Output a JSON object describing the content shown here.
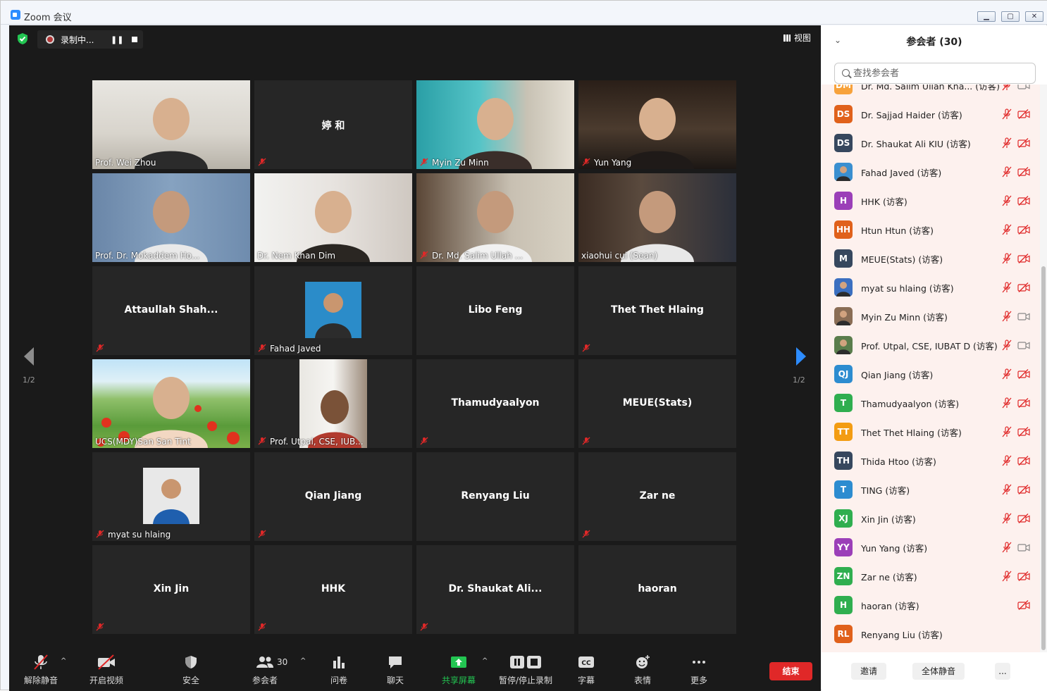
{
  "window": {
    "title": "Zoom 会议"
  },
  "topbar": {
    "recording_label": "录制中...",
    "view_label": "视图"
  },
  "tiles": [
    {
      "name": "Prof. Wei Zhou",
      "mic_off": false
    },
    {
      "name": "婷 和",
      "mic_off": true
    },
    {
      "name": "Myin Zu Minn",
      "mic_off": true
    },
    {
      "name": "Yun Yang",
      "mic_off": true
    },
    {
      "name": "Prof. Dr. Mokaddem Ho...",
      "mic_off": false
    },
    {
      "name": "Dr. Nem Khan Dim",
      "mic_off": false
    },
    {
      "name": "Dr. Md. Salim Ullah ...",
      "mic_off": true
    },
    {
      "name": "xiaohui cui (Sean)",
      "mic_off": false
    },
    {
      "name": "Attaullah  Shah...",
      "mic_off": true
    },
    {
      "name": "Fahad Javed",
      "mic_off": true
    },
    {
      "name": "Libo Feng",
      "mic_off": false
    },
    {
      "name": "Thet Thet Hlaing",
      "mic_off": true
    },
    {
      "name": "UCS(MDY)San San Tint",
      "mic_off": false
    },
    {
      "name": "Prof. Utpal, CSE, IUB...",
      "mic_off": true
    },
    {
      "name": "Thamudyaalyon",
      "mic_off": true
    },
    {
      "name": "MEUE(Stats)",
      "mic_off": true
    },
    {
      "name": "myat su hlaing",
      "mic_off": true
    },
    {
      "name": "Qian Jiang",
      "mic_off": true
    },
    {
      "name": "Renyang Liu",
      "mic_off": false
    },
    {
      "name": "Zar ne",
      "mic_off": true
    },
    {
      "name": "Xin Jin",
      "mic_off": true
    },
    {
      "name": "HHK",
      "mic_off": true
    },
    {
      "name": "Dr. Shaukat  Ali...",
      "mic_off": true
    },
    {
      "name": "haoran",
      "mic_off": false
    }
  ],
  "pagination": {
    "left": "1/2",
    "right": "1/2"
  },
  "toolbar": {
    "unmute": "解除静音",
    "start_video": "开启视频",
    "security": "安全",
    "participants": "参会者",
    "participants_count": "30",
    "polls": "问卷",
    "chat": "聊天",
    "share": "共享屏幕",
    "record": "暂停/停止录制",
    "captions": "字幕",
    "reactions": "表情",
    "more": "更多",
    "end": "结束",
    "captions_icon_text": "CC"
  },
  "panel": {
    "title": "参会者 (30)",
    "search_placeholder": "查找参会者",
    "participants": [
      {
        "initials": "DM",
        "name": "Dr. Md. Salim Ullah Kha...  (访客)",
        "color": "#f7a23b",
        "cam": "on"
      },
      {
        "initials": "DS",
        "name": "Dr. Sajjad Haider (访客)",
        "color": "#e0611b",
        "cam": "off"
      },
      {
        "initials": "DS",
        "name": "Dr. Shaukat Ali KIU (访客)",
        "color": "#36475e",
        "cam": "off"
      },
      {
        "initials": "",
        "name": "Fahad Javed (访客)",
        "color": "#3a8fd0",
        "cam": "off",
        "photo": true
      },
      {
        "initials": "H",
        "name": "HHK (访客)",
        "color": "#9b3fb8",
        "cam": "off"
      },
      {
        "initials": "HH",
        "name": "Htun Htun (访客)",
        "color": "#e0611b",
        "cam": "off"
      },
      {
        "initials": "M",
        "name": "MEUE(Stats) (访客)",
        "color": "#36475e",
        "cam": "off"
      },
      {
        "initials": "",
        "name": "myat su hlaing (访客)",
        "color": "#3b6fc0",
        "cam": "off",
        "photo": true
      },
      {
        "initials": "",
        "name": "Myin Zu Minn (访客)",
        "color": "#8a6d55",
        "cam": "on",
        "photo": true
      },
      {
        "initials": "",
        "name": "Prof. Utpal, CSE, IUBAT D (访客)",
        "color": "#5a7d4c",
        "cam": "on",
        "photo": true
      },
      {
        "initials": "QJ",
        "name": "Qian Jiang (访客)",
        "color": "#2d8cd0",
        "cam": "off"
      },
      {
        "initials": "T",
        "name": "Thamudyaalyon (访客)",
        "color": "#2fae4f",
        "cam": "off"
      },
      {
        "initials": "TT",
        "name": "Thet Thet Hlaing (访客)",
        "color": "#f39c12",
        "cam": "off"
      },
      {
        "initials": "TH",
        "name": "Thida Htoo (访客)",
        "color": "#36475e",
        "cam": "off"
      },
      {
        "initials": "T",
        "name": "TING (访客)",
        "color": "#2d8cd0",
        "cam": "off"
      },
      {
        "initials": "XJ",
        "name": "Xin Jin (访客)",
        "color": "#2fae4f",
        "cam": "off"
      },
      {
        "initials": "YY",
        "name": "Yun Yang (访客)",
        "color": "#9b3fb8",
        "cam": "on"
      },
      {
        "initials": "ZN",
        "name": "Zar ne (访客)",
        "color": "#2fae4f",
        "cam": "off"
      },
      {
        "initials": "H",
        "name": "haoran (访客)",
        "color": "#2fae4f",
        "cam": "off",
        "mic_hidden": true
      },
      {
        "initials": "RL",
        "name": "Renyang Liu (访客)",
        "color": "#e0611b",
        "cam": "none",
        "mic_hidden": true
      }
    ],
    "footer": {
      "invite": "邀请",
      "mute_all": "全体静音",
      "more": "..."
    }
  }
}
